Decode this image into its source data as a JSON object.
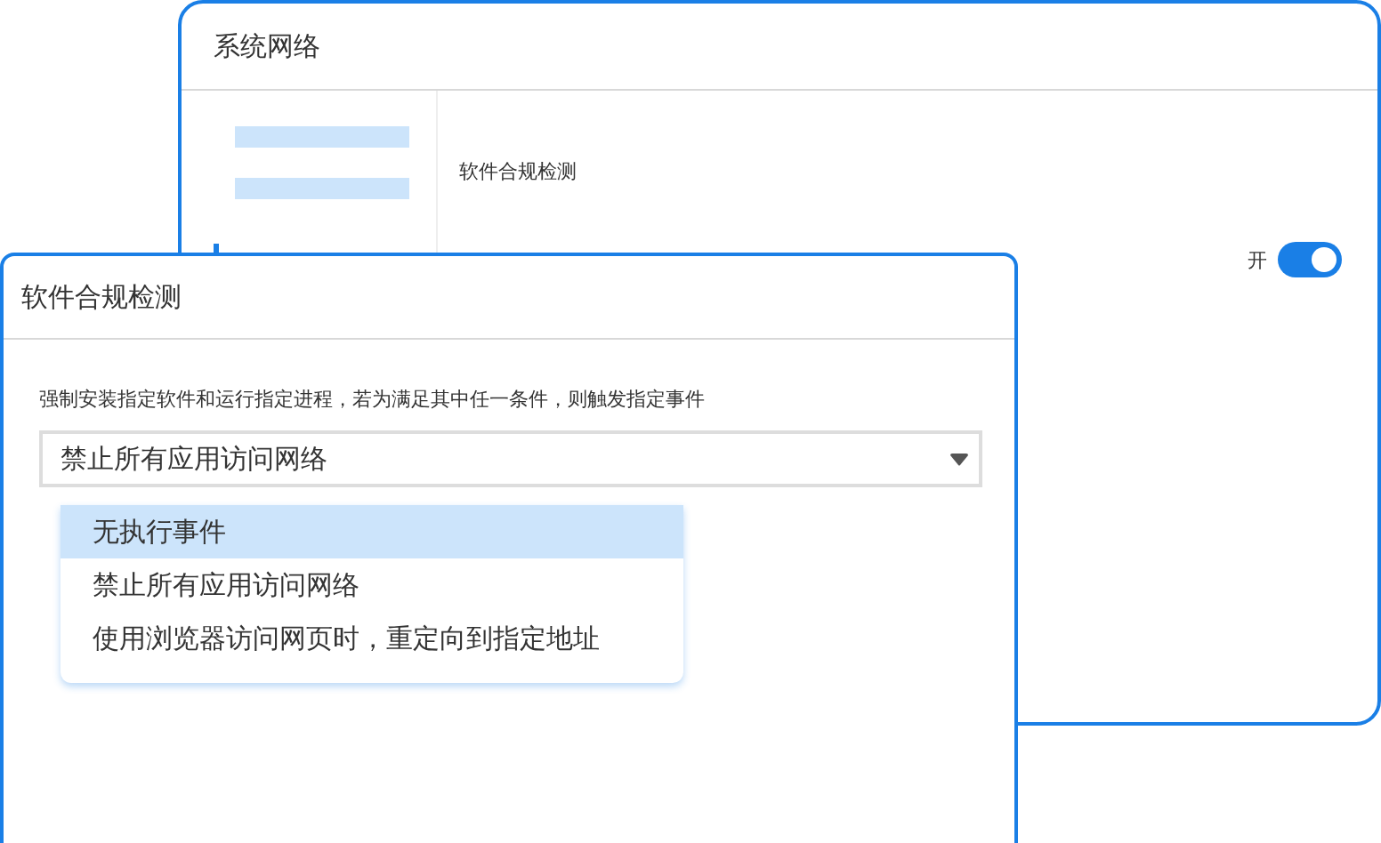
{
  "background_window": {
    "title": "系统网络",
    "setting": {
      "label": "软件合规检测",
      "toggle_label": "开",
      "on": true
    }
  },
  "dialog": {
    "title": "软件合规检测",
    "description": "强制安装指定软件和运行指定进程，若为满足其中任一条件，则触发指定事件",
    "select": {
      "value": "禁止所有应用访问网络"
    },
    "options": [
      {
        "label": "无执行事件",
        "selected": true
      },
      {
        "label": "禁止所有应用访问网络",
        "selected": false
      },
      {
        "label": "使用浏览器访问网页时，重定向到指定地址",
        "selected": false
      }
    ]
  }
}
